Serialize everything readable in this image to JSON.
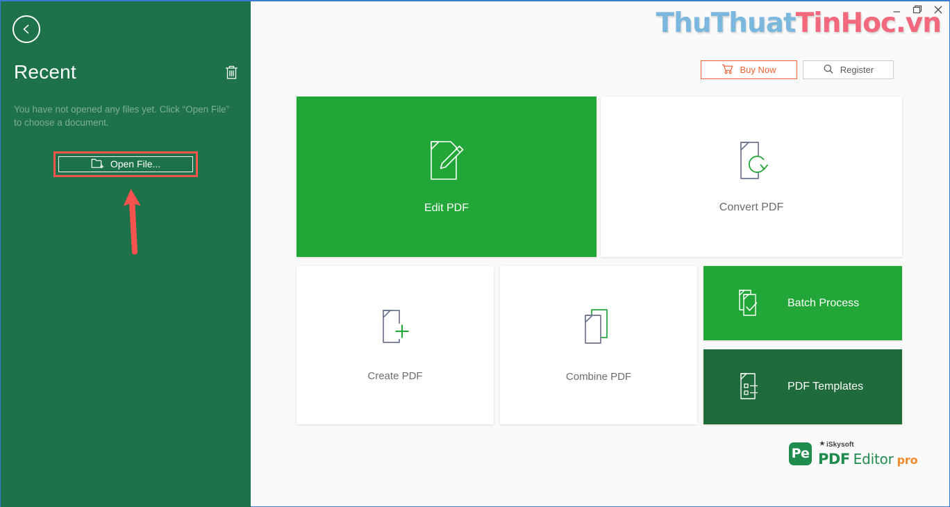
{
  "window": {
    "controls": [
      {
        "name": "minimize",
        "glyph": "—"
      },
      {
        "name": "maximize",
        "glyph": "❐"
      },
      {
        "name": "close",
        "glyph": "✕"
      }
    ]
  },
  "watermark": {
    "part1": "ThuThuat",
    "part2": "TinHoc.vn",
    "color1": "#7cb8de",
    "color2": "#f2697e"
  },
  "sidebar": {
    "background_color": "#1d7249",
    "back_button_icon": "chevron-left-icon",
    "title": "Recent",
    "delete_icon": "trash-icon",
    "description": "You have not opened any files yet. Click “Open File” to choose a document.",
    "open_file": {
      "label": "Open File...",
      "icon": "folder-add-icon",
      "highlight_color": "#f9534f"
    },
    "annotation": {
      "type": "arrow-up",
      "color": "#f9534f"
    }
  },
  "toolbar": {
    "buy_now": {
      "label": "Buy Now",
      "icon": "cart-icon",
      "color": "#f06134"
    },
    "register": {
      "label": "Register",
      "icon": "search-icon",
      "color": "#5a5a5a"
    }
  },
  "tiles": [
    {
      "id": "edit",
      "label": "Edit PDF",
      "icon": "document-pencil-icon",
      "style": "green"
    },
    {
      "id": "convert",
      "label": "Convert PDF",
      "icon": "document-refresh-icon",
      "style": "white"
    },
    {
      "id": "create",
      "label": "Create PDF",
      "icon": "document-plus-icon",
      "style": "white"
    },
    {
      "id": "combine",
      "label": "Combine PDF",
      "icon": "document-stack-icon",
      "style": "white"
    },
    {
      "id": "batch",
      "label": "Batch Process",
      "icon": "document-check-icon",
      "style": "green"
    },
    {
      "id": "templates",
      "label": "PDF Templates",
      "icon": "document-list-icon",
      "style": "dark-green"
    }
  ],
  "brand": {
    "badge": "Pe",
    "company": "iSkysoft",
    "product_1": "PDF",
    "product_2": "Editor",
    "edition": "pro",
    "green": "#1f8b4d",
    "orange": "#f08a2a"
  },
  "colors": {
    "sidebar_green": "#1d7249",
    "tile_green": "#23a638",
    "tile_dark_green": "#1f6b3b",
    "page_background": "#fafafa",
    "icon_slate": "#6f7490",
    "accent_green": "#2aa13a"
  }
}
